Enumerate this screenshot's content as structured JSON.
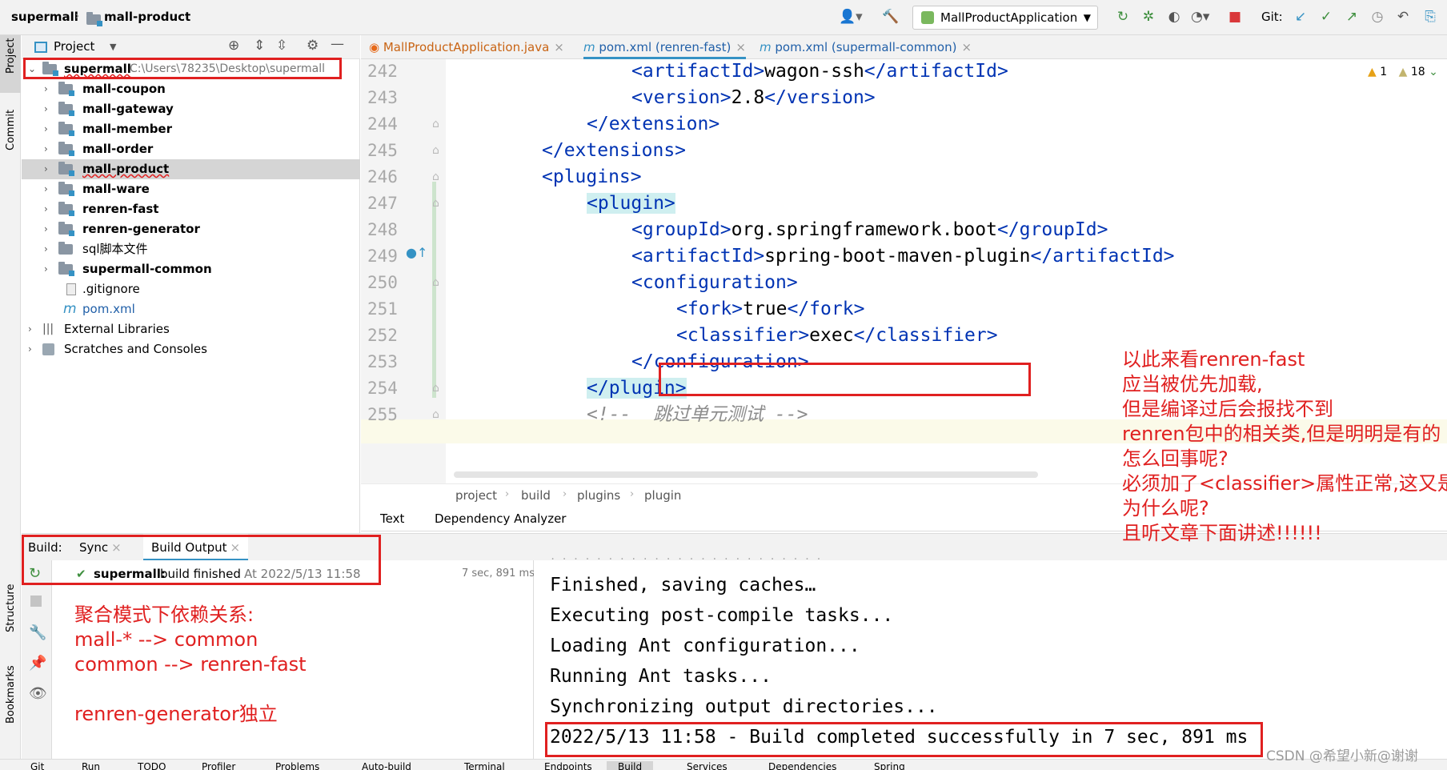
{
  "window": {
    "breadcrumb_root": "supermall",
    "breadcrumb_module": "mall-product",
    "run_config": "MallProductApplication",
    "git_label": "Git:"
  },
  "left_strip": {
    "project": "Project",
    "commit": "Commit",
    "structure": "Structure",
    "bookmarks": "Bookmarks"
  },
  "project_panel": {
    "title": "Project",
    "root_name": "supermall",
    "root_path": "C:\\Users\\78235\\Desktop\\supermall",
    "items": [
      {
        "label": "mall-coupon"
      },
      {
        "label": "mall-gateway"
      },
      {
        "label": "mall-member"
      },
      {
        "label": "mall-order"
      },
      {
        "label": "mall-product"
      },
      {
        "label": "mall-ware"
      },
      {
        "label": "renren-fast"
      },
      {
        "label": "renren-generator"
      },
      {
        "label": "sql脚本文件"
      },
      {
        "label": "supermall-common"
      },
      {
        "label": ".gitignore"
      },
      {
        "label": "pom.xml"
      },
      {
        "label": "External Libraries"
      },
      {
        "label": "Scratches and Consoles"
      }
    ]
  },
  "editor": {
    "tabs": [
      {
        "label": "MallProductApplication.java"
      },
      {
        "label": "pom.xml (renren-fast)"
      },
      {
        "label": "pom.xml (supermall-common)"
      }
    ],
    "warnings": "1",
    "weak_warnings": "18",
    "lines": [
      {
        "num": "242",
        "open": "<artifactId>",
        "text": "wagon-ssh",
        "close": "</artifactId>"
      },
      {
        "num": "243",
        "open": "<version>",
        "text": "2.8",
        "close": "</version>"
      },
      {
        "num": "244",
        "open": "</extension>",
        "text": "",
        "close": ""
      },
      {
        "num": "245",
        "open": "</extensions>",
        "text": "",
        "close": ""
      },
      {
        "num": "246",
        "open": "<plugins>",
        "text": "",
        "close": ""
      },
      {
        "num": "247",
        "open": "<plugin>",
        "text": "",
        "close": ""
      },
      {
        "num": "248",
        "open": "<groupId>",
        "text": "org.springframework.boot",
        "close": "</groupId>"
      },
      {
        "num": "249",
        "open": "<artifactId>",
        "text": "spring-boot-maven-plugin",
        "close": "</artifactId>"
      },
      {
        "num": "250",
        "open": "<configuration>",
        "text": "",
        "close": ""
      },
      {
        "num": "251",
        "open": "<fork>",
        "text": "true",
        "close": "</fork>"
      },
      {
        "num": "252",
        "open": "<classifier>",
        "text": "exec",
        "close": "</classifier>"
      },
      {
        "num": "253",
        "open": "</configuration>",
        "text": "",
        "close": ""
      },
      {
        "num": "254",
        "open": "</plugin>",
        "text": "",
        "close": ""
      },
      {
        "num": "255",
        "open": "<!--  跳过单元测试 -->",
        "text": "",
        "close": ""
      }
    ],
    "breadcrumbs": [
      "project",
      "build",
      "plugins",
      "plugin"
    ],
    "bottom_tabs": [
      "Text",
      "Dependency Analyzer"
    ]
  },
  "build": {
    "label": "Build:",
    "tab_sync": "Sync",
    "tab_output": "Build Output",
    "status_project": "supermall:",
    "status_text": "build finished",
    "status_time": "At 2022/5/13 11:58",
    "duration": "7 sec, 891 ms",
    "console": [
      "Finished, saving caches…",
      "Executing post-compile tasks...",
      "Loading Ant configuration...",
      "Running Ant tasks...",
      "Synchronizing output directories...",
      "2022/5/13 11:58 - Build completed successfully in 7 sec, 891 ms"
    ]
  },
  "bottom_bar": [
    "Git",
    "Run",
    "TODO",
    "Profiler",
    "Problems",
    "Auto-build",
    "Terminal",
    "Endpoints",
    "Build",
    "Services",
    "Dependencies",
    "Spring"
  ],
  "annotations": {
    "right_note": [
      "以此来看renren-fast",
      "应当被优先加载,",
      "但是编译过后会报找不到",
      "renren包中的相关类,但是明明是有的",
      "怎么回事呢?",
      "必须加了<classifier>属性正常,这又是",
      "为什么呢?",
      "且听文章下面讲述!!!!!!"
    ],
    "left_note": [
      "聚合模式下依赖关系:",
      "mall-* --> common",
      "common --> renren-fast",
      "",
      "renren-generator独立"
    ],
    "watermark": "CSDN @希望小新@谢谢"
  },
  "colors": {
    "tag": "#0033b3",
    "annotation_red": "#e02020",
    "selection": "#d5d5d5",
    "bracket_highlight": "#cfeff0"
  }
}
